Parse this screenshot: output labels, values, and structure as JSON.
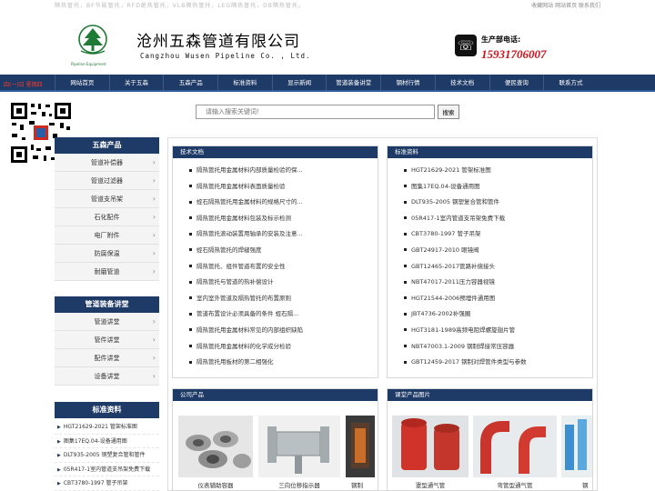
{
  "top": {
    "keywords": "隔热管托，BF节能管托，RFD绝热管托，VLB隔热管托，LEG隔热管托，DB隔热管托。",
    "links": "收藏网站 网站首页 联系我们"
  },
  "header": {
    "company_cn": "沧州五森管道有限公司",
    "company_en": "Cangzhou Wusen Pipeline Co. , Ltd.",
    "logo_sub": "Pipeline Equipment",
    "phone_label": "生产部电话:",
    "phone_number": "15931706007"
  },
  "nav": {
    "date": "四(一)日  星期四",
    "items": [
      "网站首页",
      "关于五森",
      "五森产品",
      "标准资料",
      "显示新闻",
      "管道装备讲堂",
      "钢材行情",
      "技术文档",
      "便民查询",
      "联系方式"
    ]
  },
  "search": {
    "placeholder": "请输入搜索关键词！",
    "button": "搜索"
  },
  "sidebar": {
    "products": {
      "title": "五森产品",
      "items": [
        "管道补偿器",
        "管道过滤器",
        "管道支吊架",
        "石化配件",
        "电厂附件",
        "防腐保温",
        "耐磨管道"
      ]
    },
    "lectures": {
      "title": "管道装备讲堂",
      "items": [
        "管道讲堂",
        "管件讲堂",
        "配件讲堂",
        "设备讲堂"
      ]
    },
    "standards": {
      "title": "标准资料",
      "items": [
        "HGT21629-2021 管架标准图",
        "图集17EQ.04-设备通用图",
        "DLT935-2005 钢塑复合管和管件",
        "05R417-1室内管道支吊架免费下载",
        "CBT3780-1997 管子吊架"
      ]
    }
  },
  "panels": {
    "tech": {
      "title": "技术文档",
      "items": [
        "隔热管托用金属材料内部质量检验的保...",
        "隔热管托用金属材料表面质量检验",
        "蛭石隔热管托用金属材料的规格尺寸的...",
        "隔热管托用金属材料包装及标示检测",
        "隔热管托滚动装置用轴承的安装及注意...",
        "蛭石隔热管托的焊缝强度",
        "隔热管托、组件管道布置的安全性",
        "隔热管托与管道的热补偿设计",
        "室内室外管道及隔热管托的布置原则",
        "管道布置设计必须具备的条件 蛭石隔...",
        "隔热管托用金属材料常见的内部组织缺陷",
        "隔热管托用金属材料的化学成分检验",
        "隔热管托用板材的第二相强化"
      ]
    },
    "standards": {
      "title": "标准资料",
      "items": [
        "HGT21629-2021 管架标准图",
        "图集17EQ.04-设备通用图",
        "DLT935-2005 钢塑复合管和管件",
        "05R417-1室内管道支吊架免费下载",
        "CBT3780-1997 管子吊架",
        "GBT24917-2010 眼镜阀",
        "GBT12465-2017管路补偿接头",
        "NBT47017-2011压力容器视镜",
        "HGT21544-2006预埋件通用图",
        "JBT4736-2002补强圈",
        "HGT3181-1989高频电阻焊螺旋翅片管",
        "NBT47003.1-2009 钢制焊接常压容器",
        "GBT12459-2017 钢制对焊管件类型与参数"
      ]
    },
    "company_products": {
      "title": "公司产品",
      "captions": [
        "仪表辅助容器",
        "三向位移指示器",
        "钢制"
      ]
    },
    "class_images": {
      "title": "课堂产品图片",
      "captions": [
        "罩型通气管",
        "弯管型通气管",
        "钢"
      ]
    }
  }
}
